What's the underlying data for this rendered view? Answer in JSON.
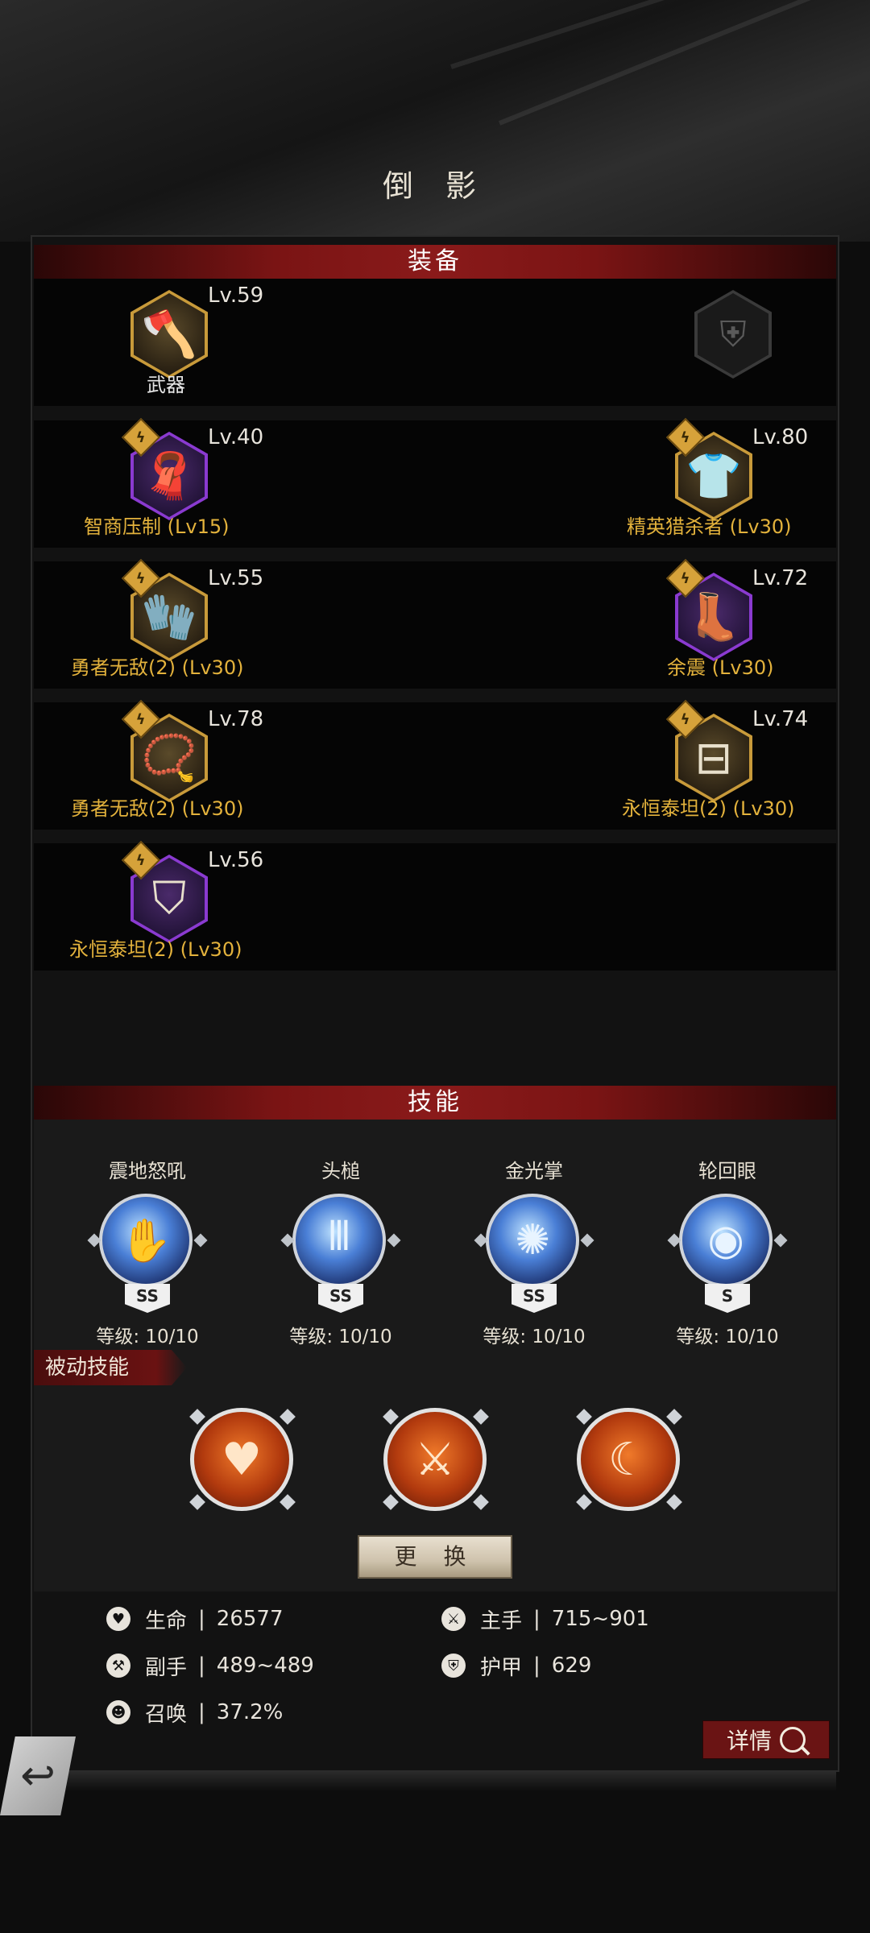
{
  "page": {
    "title": "倒 影"
  },
  "equipment": {
    "header": "装备",
    "weapon": {
      "level": "Lv.59",
      "name": "武器",
      "icon": "axe-icon"
    },
    "empty_slot": {
      "icon": "shield-icon"
    },
    "items": [
      {
        "level": "Lv.40",
        "name": "智商压制 (Lv15)",
        "icon": "scarf-icon",
        "frame": "purple"
      },
      {
        "level": "Lv.80",
        "name": "精英猎杀者 (Lv30)",
        "icon": "armor-icon",
        "frame": "gold"
      },
      {
        "level": "Lv.55",
        "name": "勇者无敌(2) (Lv30)",
        "icon": "glove-icon",
        "frame": "gold"
      },
      {
        "level": "Lv.72",
        "name": "余震 (Lv30)",
        "icon": "boots-icon",
        "frame": "purple"
      },
      {
        "level": "Lv.78",
        "name": "勇者无敌(2) (Lv30)",
        "icon": "necklace-icon",
        "frame": "gold"
      },
      {
        "level": "Lv.74",
        "name": "永恒泰坦(2) (Lv30)",
        "icon": "belt-icon",
        "frame": "gold"
      },
      {
        "level": "Lv.56",
        "name": "永恒泰坦(2) (Lv30)",
        "icon": "cloak-icon",
        "frame": "purple"
      }
    ]
  },
  "skills": {
    "header": "技能",
    "items": [
      {
        "name": "震地怒吼",
        "grade": "SS",
        "level": "等级: 10/10",
        "icon": "roar-icon"
      },
      {
        "name": "头槌",
        "grade": "SS",
        "level": "等级: 10/10",
        "icon": "headbutt-icon"
      },
      {
        "name": "金光掌",
        "grade": "SS",
        "level": "等级: 10/10",
        "icon": "palm-icon"
      },
      {
        "name": "轮回眼",
        "grade": "S",
        "level": "等级: 10/10",
        "icon": "eye-icon"
      }
    ],
    "passive_label": "被动技能",
    "passives": [
      {
        "icon": "heart-hands-icon"
      },
      {
        "icon": "sword-icon"
      },
      {
        "icon": "elements-icon"
      }
    ],
    "swap_label": "更 换"
  },
  "stats": [
    {
      "label": "生命",
      "value": "26577",
      "icon": "heart-icon"
    },
    {
      "label": "主手",
      "value": "715~901",
      "icon": "main-hand-icon"
    },
    {
      "label": "副手",
      "value": "489~489",
      "icon": "off-hand-icon"
    },
    {
      "label": "护甲",
      "value": "629",
      "icon": "armor-stat-icon"
    },
    {
      "label": "召唤",
      "value": "37.2%",
      "icon": "summon-icon"
    }
  ],
  "stat_separator": "|",
  "details_label": "详情"
}
